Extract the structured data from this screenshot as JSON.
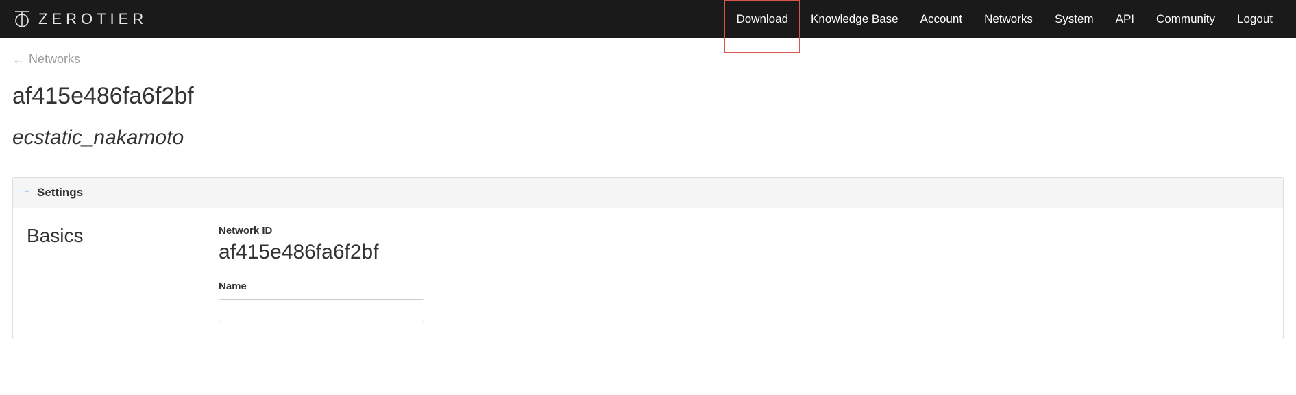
{
  "brand": {
    "name": "ZEROTIER"
  },
  "nav": {
    "download": "Download",
    "knowledge_base": "Knowledge Base",
    "account": "Account",
    "networks": "Networks",
    "system": "System",
    "api": "API",
    "community": "Community",
    "logout": "Logout"
  },
  "page": {
    "back_label": "Networks",
    "network_id": "af415e486fa6f2bf",
    "network_name": "ecstatic_nakamoto"
  },
  "panel": {
    "settings_title": "Settings",
    "basics": {
      "title": "Basics",
      "network_id_label": "Network ID",
      "network_id_value": "af415e486fa6f2bf",
      "name_label": "Name",
      "name_value": ""
    }
  }
}
